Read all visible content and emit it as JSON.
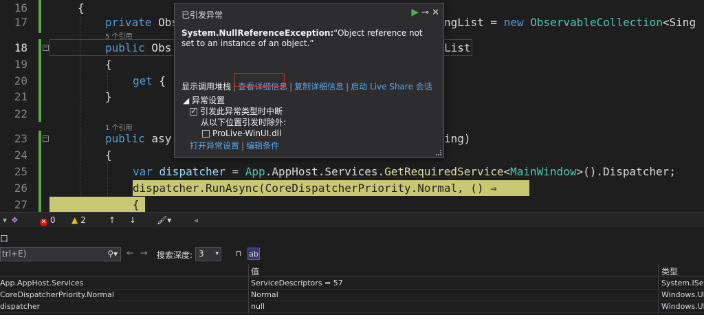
{
  "editor": {
    "lines": [
      {
        "num": "16",
        "ref": ""
      },
      {
        "num": "17",
        "ref": "5 个引用"
      },
      {
        "num": "18",
        "ref": ""
      },
      {
        "num": "19",
        "ref": ""
      },
      {
        "num": "20",
        "ref": ""
      },
      {
        "num": "21",
        "ref": ""
      },
      {
        "num": "22",
        "ref": "1 个引用"
      },
      {
        "num": "23",
        "ref": ""
      },
      {
        "num": "24",
        "ref": ""
      },
      {
        "num": "25",
        "ref": ""
      },
      {
        "num": "26",
        "ref": ""
      },
      {
        "num": "27",
        "ref": ""
      }
    ],
    "code": {
      "l16": "{",
      "l17_kw": "private",
      "l17_a": " Obs",
      "l17_b": "ngList = ",
      "l17_new": "new",
      "l17_type": " ObservableCollection",
      "l17_c": "<Sing",
      "l18_kw": "public",
      "l18_a": " Obs",
      "l18_b": "List",
      "l19": "{",
      "l20_kw": "get",
      "l20_a": " {",
      "l21": "}",
      "l23_kw": "public",
      "l23_a": " asy",
      "l23_b": "ing)",
      "l24": "{",
      "l25_kw": "var",
      "l25_var": " dispatcher",
      "l25_a": " = ",
      "l25_type1": "App",
      "l25_b": ".AppHost.",
      "l25_c": "Services.",
      "l25_method": "GetRequiredService",
      "l25_d": "<",
      "l25_type2": "MainWindow",
      "l25_e": ">().Dispatcher;",
      "l26": "dispatcher.RunAsync(CoreDispatcherPriority.Normal, () ⇒",
      "l27": "{"
    }
  },
  "exception_popup": {
    "title": "已引发异常",
    "exception_type": "System.NullReferenceException:",
    "message": "“Object reference not set to an instance of an object.”",
    "links": {
      "call_stack": "显示调用堆栈",
      "view_details": "查看详细信息",
      "copy_details": "复制详细信息",
      "live_share": "启动 Live Share 会话"
    },
    "settings": {
      "header": "异常设置",
      "break_when_thrown": "引发此异常类型时中断",
      "except_from": "从以下位置引发时除外:",
      "module": "ProLive-WinUI.dll",
      "break_checked": true,
      "module_checked": false
    },
    "bottom_links": {
      "open_settings": "打开异常设置",
      "edit_conditions": "编辑条件"
    }
  },
  "status_bar": {
    "errors": "0",
    "warnings": "2"
  },
  "watch_panel": {
    "tab_label": "口",
    "search_placeholder": "trl+E)",
    "search_depth_label": "搜索深度:",
    "search_depth_value": "3",
    "columns": {
      "name": "",
      "value": "值",
      "type": "类型"
    },
    "rows": [
      {
        "name": "App.AppHost.Services",
        "value": "ServiceDescriptors = 57",
        "type": "System.IServ"
      },
      {
        "name": "CoreDispatcherPriority.Normal",
        "value": "Normal",
        "type": "Windows.UI"
      },
      {
        "name": "dispatcher",
        "value": "null",
        "type": "Windows.UI"
      }
    ]
  }
}
